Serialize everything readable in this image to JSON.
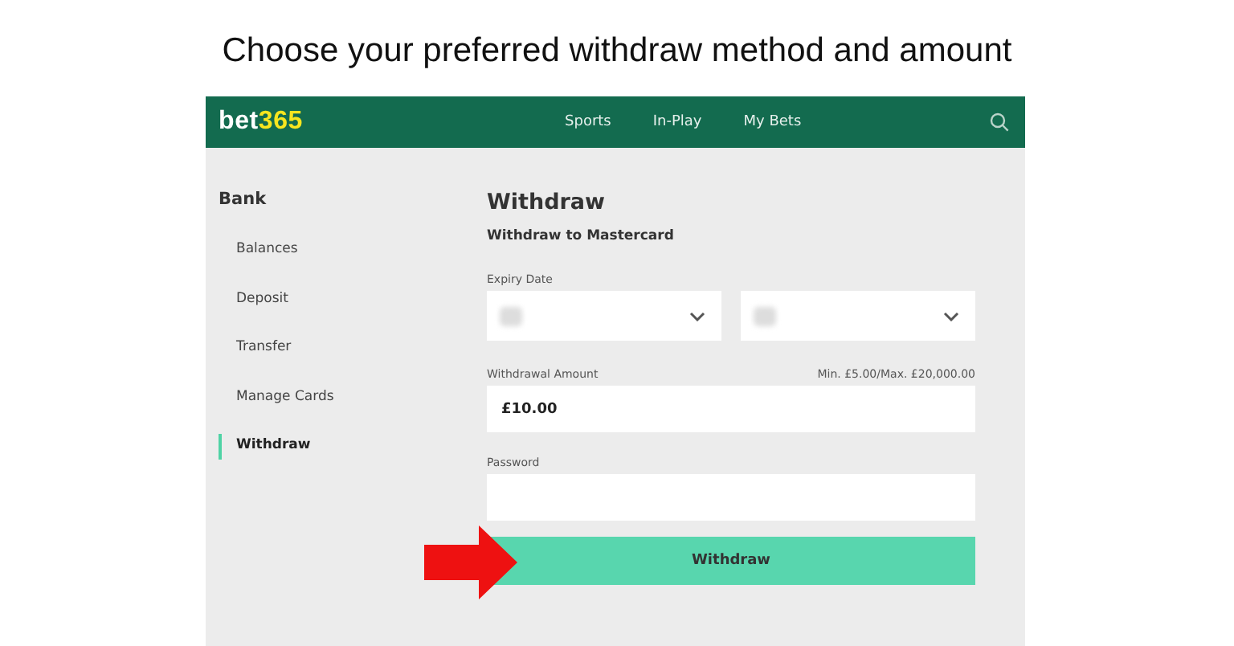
{
  "heading": "Choose your preferred withdraw method and amount",
  "header": {
    "logo": [
      "bet",
      "365"
    ],
    "nav": [
      {
        "label": "Sports"
      },
      {
        "label": "In-Play"
      },
      {
        "label": "My Bets"
      }
    ]
  },
  "sidebar": {
    "title": "Bank",
    "items": [
      {
        "label": "Balances",
        "selected": false
      },
      {
        "label": "Deposit",
        "selected": false
      },
      {
        "label": "Transfer",
        "selected": false
      },
      {
        "label": "Manage Cards",
        "selected": false
      },
      {
        "label": "Withdraw",
        "selected": true
      }
    ]
  },
  "form": {
    "title": "Withdraw",
    "subtitle": "Withdraw to Mastercard",
    "expiry_label": "Expiry Date",
    "amount_label": "Withdrawal Amount",
    "amount_limits": "Min. £5.00/Max. £20,000.00",
    "amount_value": "£10.00",
    "password_label": "Password",
    "submit": "Withdraw"
  }
}
